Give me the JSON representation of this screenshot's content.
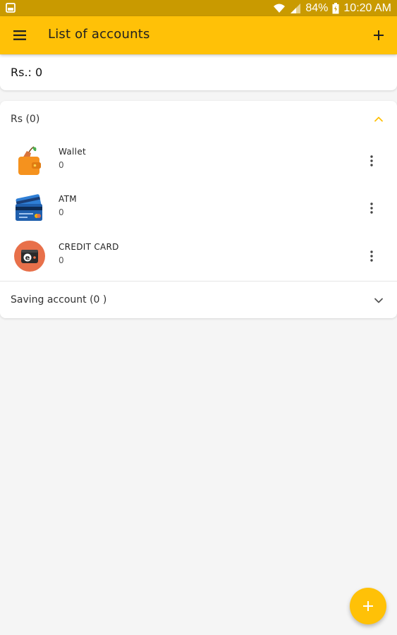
{
  "status_bar": {
    "battery": "84%",
    "time": "10:20 AM"
  },
  "app_bar": {
    "title": "List of accounts",
    "menu_icon": "hamburger-menu-icon",
    "add_icon": "plus-icon"
  },
  "total": {
    "text": "Rs.: 0"
  },
  "groups": [
    {
      "label": "Rs (0)",
      "expanded": true,
      "accounts": [
        {
          "name": "Wallet",
          "balance": "0",
          "icon": "wallet-icon"
        },
        {
          "name": "ATM",
          "balance": "0",
          "icon": "atm-card-icon"
        },
        {
          "name": "CREDIT CARD",
          "balance": "0",
          "icon": "credit-card-icon"
        }
      ]
    },
    {
      "label": "Saving account (0 )",
      "expanded": false
    }
  ],
  "colors": {
    "primary": "#ffc107",
    "status_bar": "#c99a00",
    "background": "#f5f5f5",
    "chevron_up": "#ffc107",
    "credit_card_icon_bg": "#e8704a"
  }
}
